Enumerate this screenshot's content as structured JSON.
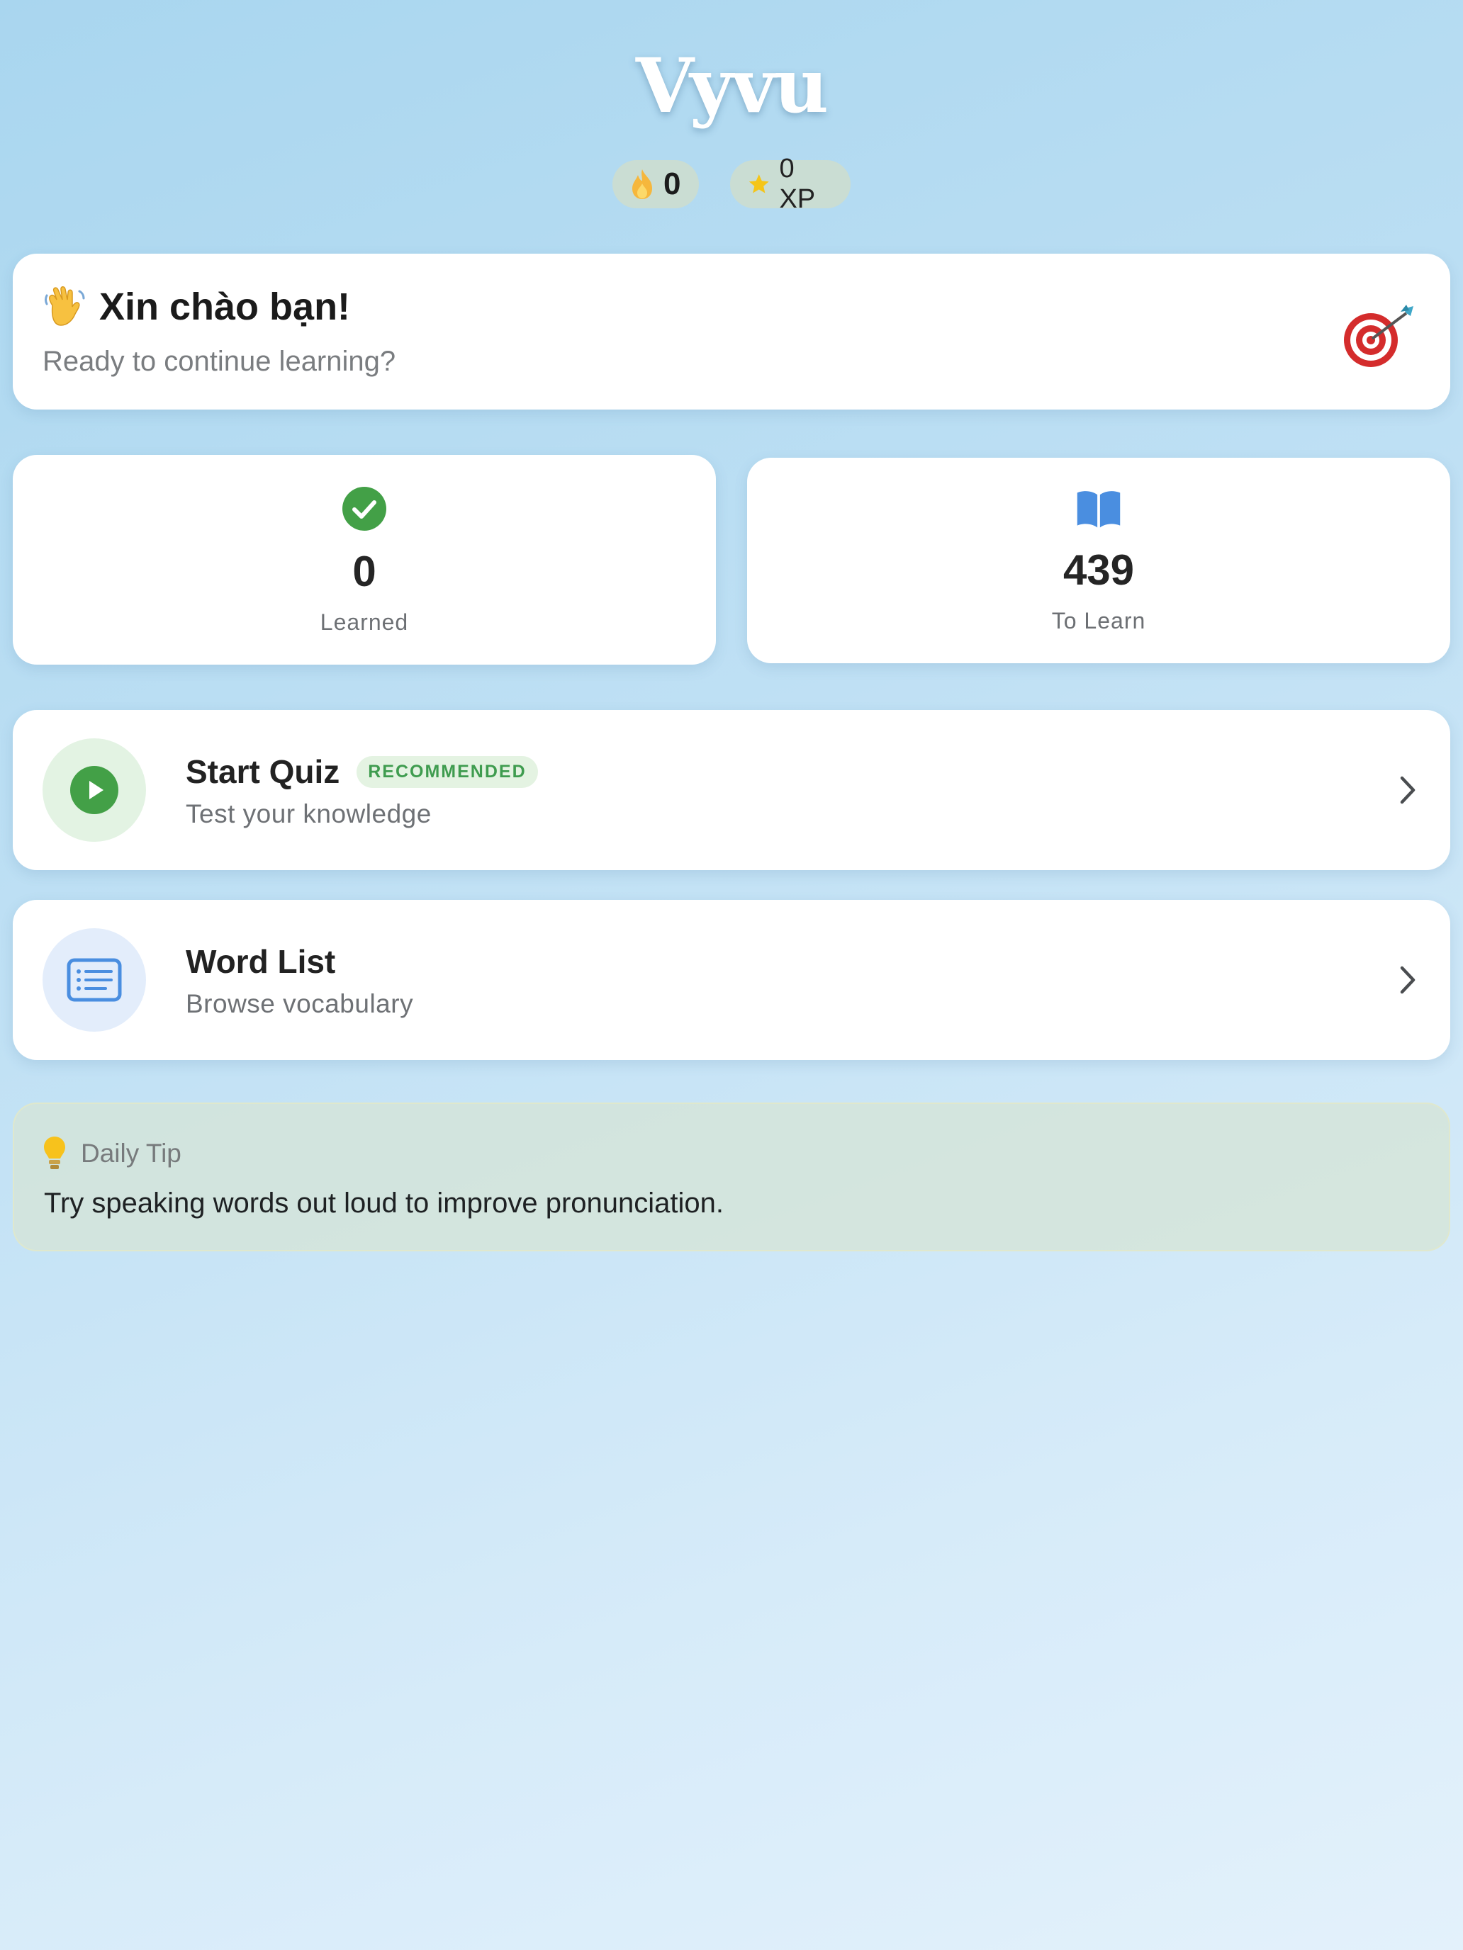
{
  "header": {
    "app_title": "Vyvu",
    "streak": {
      "icon": "flame-icon",
      "value": "0"
    },
    "xp": {
      "icon": "star-icon",
      "label": "0 XP"
    }
  },
  "greeting": {
    "emoji_icon": "waving-hand-icon",
    "title": "Xin chào bạn!",
    "subtitle": "Ready to continue learning?",
    "decor_icon": "target-dart-icon"
  },
  "stats": [
    {
      "icon": "check-circle-icon",
      "value": "0",
      "label": "Learned"
    },
    {
      "icon": "open-book-icon",
      "value": "439",
      "label": "To Learn"
    }
  ],
  "actions": {
    "quiz": {
      "icon": "play-icon",
      "title": "Start Quiz",
      "badge": "RECOMMENDED",
      "subtitle": "Test your knowledge"
    },
    "word_list": {
      "icon": "list-icon",
      "title": "Word List",
      "subtitle": "Browse vocabulary"
    }
  },
  "tip": {
    "icon": "lightbulb-icon",
    "heading": "Daily Tip",
    "text": "Try speaking words out loud to improve pronunciation."
  },
  "colors": {
    "accent_green": "#43a047",
    "accent_blue": "#4a8ee0",
    "badge_green_text": "#3f9c4f",
    "gold": "#f5c518"
  }
}
